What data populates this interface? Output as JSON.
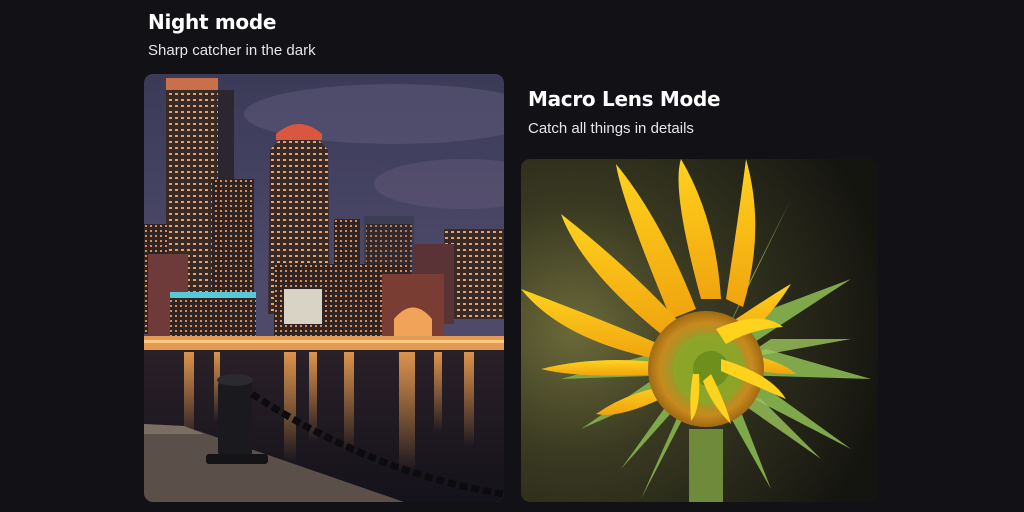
{
  "night": {
    "title": "Night mode",
    "subtitle": "Sharp catcher in the dark",
    "image_label": "night-city-photo"
  },
  "macro": {
    "title": "Macro Lens Mode",
    "subtitle": "Catch all things in details",
    "image_label": "sunflower-macro-photo"
  },
  "colors": {
    "background": "#111116",
    "heading": "#ffffff",
    "subheading": "#e6e6e6"
  }
}
